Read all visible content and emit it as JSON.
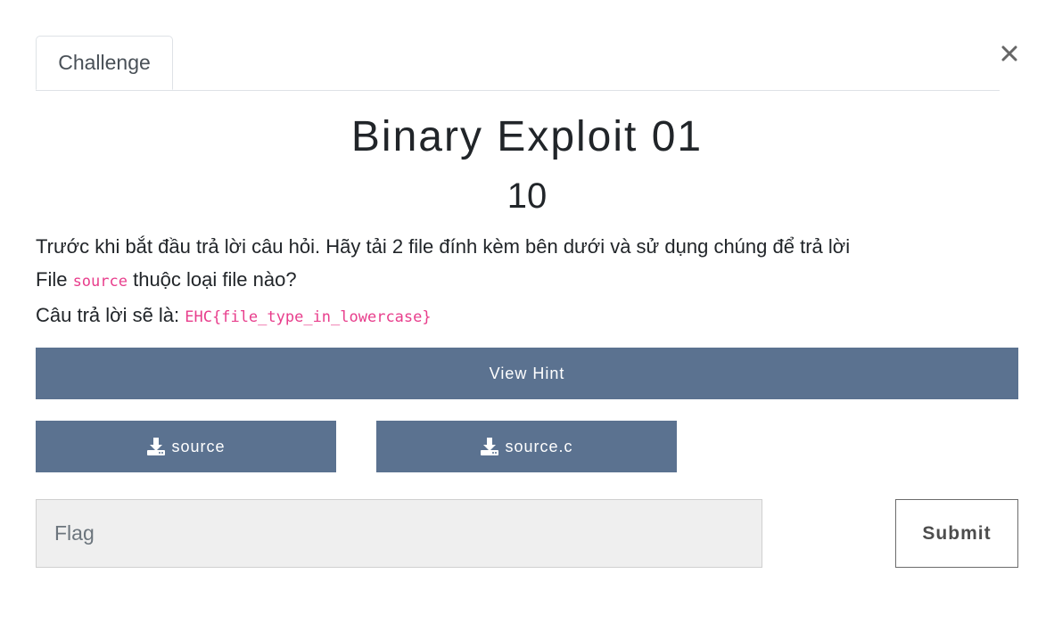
{
  "tabs": [
    {
      "label": "Challenge"
    }
  ],
  "close_label": "×",
  "challenge": {
    "name": "Binary Exploit 01",
    "points": "10",
    "description": {
      "line1": "Trước khi bắt đầu trả lời câu hỏi. Hãy tải 2 file đính kèm bên dưới và sử dụng chúng để trả lời",
      "line2_prefix": "File ",
      "line2_code": "source",
      "line2_suffix": " thuộc loại file nào?",
      "line3_prefix": "Câu trả lời sẽ là: ",
      "line3_code": "EHC{file_type_in_lowercase}"
    }
  },
  "buttons": {
    "hint": "View Hint",
    "files": [
      {
        "label": "source",
        "icon": "download-icon"
      },
      {
        "label": "source.c",
        "icon": "download-icon"
      }
    ],
    "submit": "Submit"
  },
  "flag_input": {
    "placeholder": "Flag",
    "value": ""
  },
  "colors": {
    "button_bg": "#5b7290",
    "code": "#e83e8c",
    "input_bg": "#efefef"
  }
}
